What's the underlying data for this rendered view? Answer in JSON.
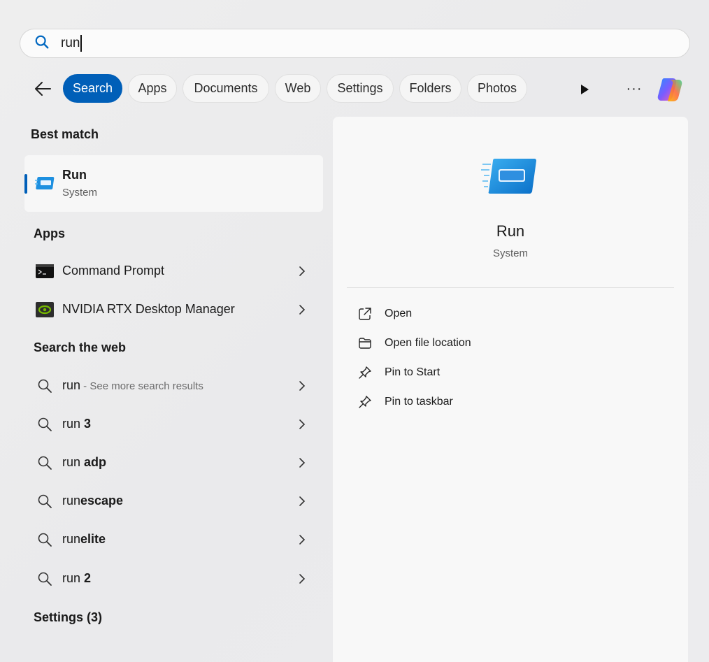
{
  "search": {
    "value": "run"
  },
  "filters": {
    "chips": [
      {
        "label": "Search",
        "active": true
      },
      {
        "label": "Apps"
      },
      {
        "label": "Documents"
      },
      {
        "label": "Web"
      },
      {
        "label": "Settings"
      },
      {
        "label": "Folders"
      },
      {
        "label": "Photos"
      }
    ],
    "more_label": "···"
  },
  "best_match": {
    "title": "Best match",
    "name": "Run",
    "subtitle": "System"
  },
  "apps": {
    "title": "Apps",
    "items": [
      {
        "label": "Command Prompt",
        "icon": "command-prompt-icon"
      },
      {
        "label": "NVIDIA RTX Desktop Manager",
        "icon": "nvidia-icon"
      }
    ]
  },
  "web": {
    "title": "Search the web",
    "items": [
      {
        "prefix": "run",
        "suffix": "",
        "extra": " - See more search results"
      },
      {
        "prefix": "run ",
        "suffix": "3",
        "extra": ""
      },
      {
        "prefix": "run ",
        "suffix": "adp",
        "extra": ""
      },
      {
        "prefix": "run",
        "suffix": "escape",
        "extra": ""
      },
      {
        "prefix": "run",
        "suffix": "elite",
        "extra": ""
      },
      {
        "prefix": "run ",
        "suffix": "2",
        "extra": ""
      }
    ]
  },
  "settings": {
    "title": "Settings (3)"
  },
  "detail": {
    "name": "Run",
    "subtitle": "System",
    "actions": [
      {
        "label": "Open",
        "icon": "open-external-icon"
      },
      {
        "label": "Open file location",
        "icon": "folder-icon"
      },
      {
        "label": "Pin to Start",
        "icon": "pin-icon"
      },
      {
        "label": "Pin to taskbar",
        "icon": "pin-icon"
      }
    ]
  },
  "colors": {
    "accent": "#005fb8"
  }
}
